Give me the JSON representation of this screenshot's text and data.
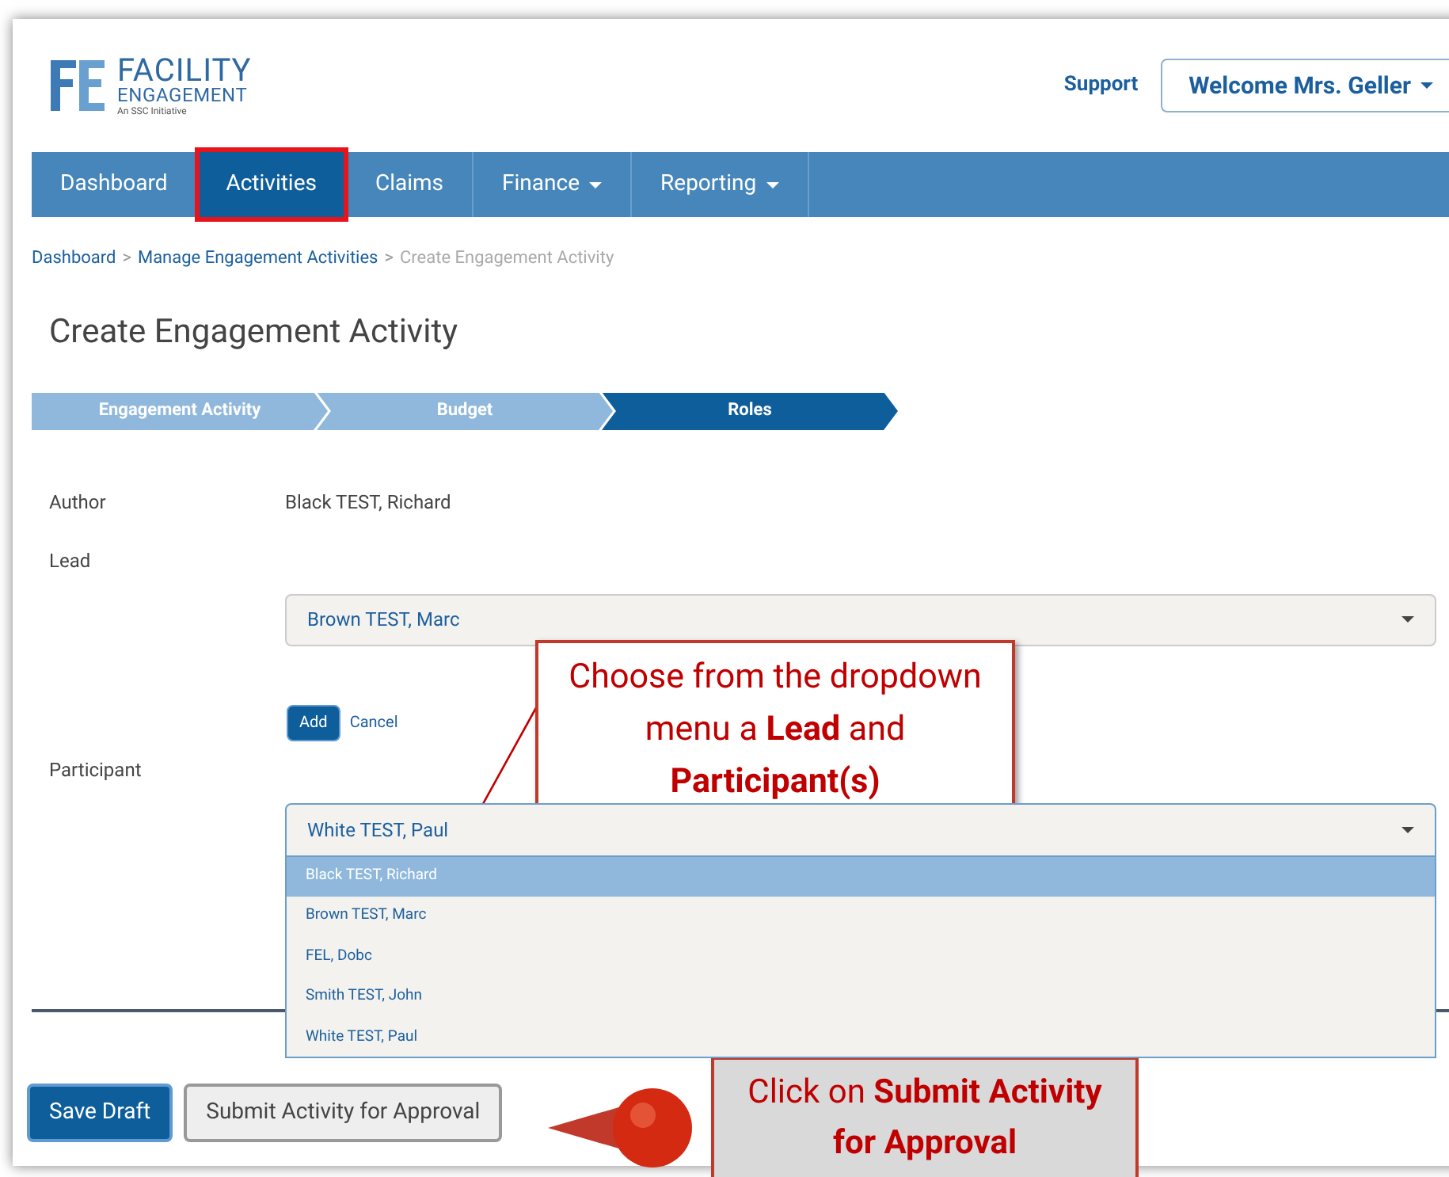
{
  "header": {
    "logo": {
      "title": "FACILITY",
      "subtitle": "ENGAGEMENT",
      "tagline": "An SSC Initiative"
    },
    "support_link": "Support",
    "user_menu": "Welcome Mrs. Geller"
  },
  "nav": [
    {
      "label": "Dashboard",
      "selected": false,
      "dropdown": false,
      "highlighted": false
    },
    {
      "label": "Activities",
      "selected": true,
      "dropdown": false,
      "highlighted": true
    },
    {
      "label": "Claims",
      "selected": false,
      "dropdown": false,
      "highlighted": false
    },
    {
      "label": "Finance",
      "selected": false,
      "dropdown": true,
      "highlighted": false
    },
    {
      "label": "Reporting",
      "selected": false,
      "dropdown": true,
      "highlighted": false
    }
  ],
  "breadcrumb": [
    {
      "kind": "link",
      "label": "Dashboard"
    },
    {
      "kind": "separator",
      "label": ">"
    },
    {
      "kind": "link",
      "label": "Manage Engagement Activities"
    },
    {
      "kind": "separator",
      "label": ">"
    },
    {
      "kind": "current",
      "label": "Create Engagement Activity"
    }
  ],
  "title": "Create Engagement Activity",
  "steps": [
    {
      "label": "Engagement Activity",
      "selected": false
    },
    {
      "label": "Budget",
      "selected": false
    },
    {
      "label": "Roles",
      "selected": true
    }
  ],
  "form": {
    "author_label": "Author",
    "author_value": "Black TEST, Richard",
    "lead_label": "Lead",
    "lead_value": "Brown TEST, Marc",
    "add_button": "Add",
    "cancel_link": "Cancel",
    "participant_label": "Participant",
    "participant_value": "White TEST, Paul",
    "options": [
      {
        "label": "Black TEST, Richard",
        "selected": true
      },
      {
        "label": "Brown TEST, Marc",
        "selected": false
      },
      {
        "label": "FEL, Dobc",
        "selected": false
      },
      {
        "label": "Smith TEST, John",
        "selected": false
      },
      {
        "label": "White TEST, Paul",
        "selected": false
      }
    ]
  },
  "buttons": [
    {
      "label": "Save Draft",
      "kind": "primary"
    },
    {
      "label": "Submit Activity for Approval",
      "kind": "secondary"
    }
  ],
  "callouts": [
    {
      "kind": "note",
      "text": "Choose from the dropdown menu a **Lead** and **Participant(s)**"
    },
    {
      "kind": "pointer",
      "text": "Click on **Submit Activity for Approval**"
    }
  ]
}
